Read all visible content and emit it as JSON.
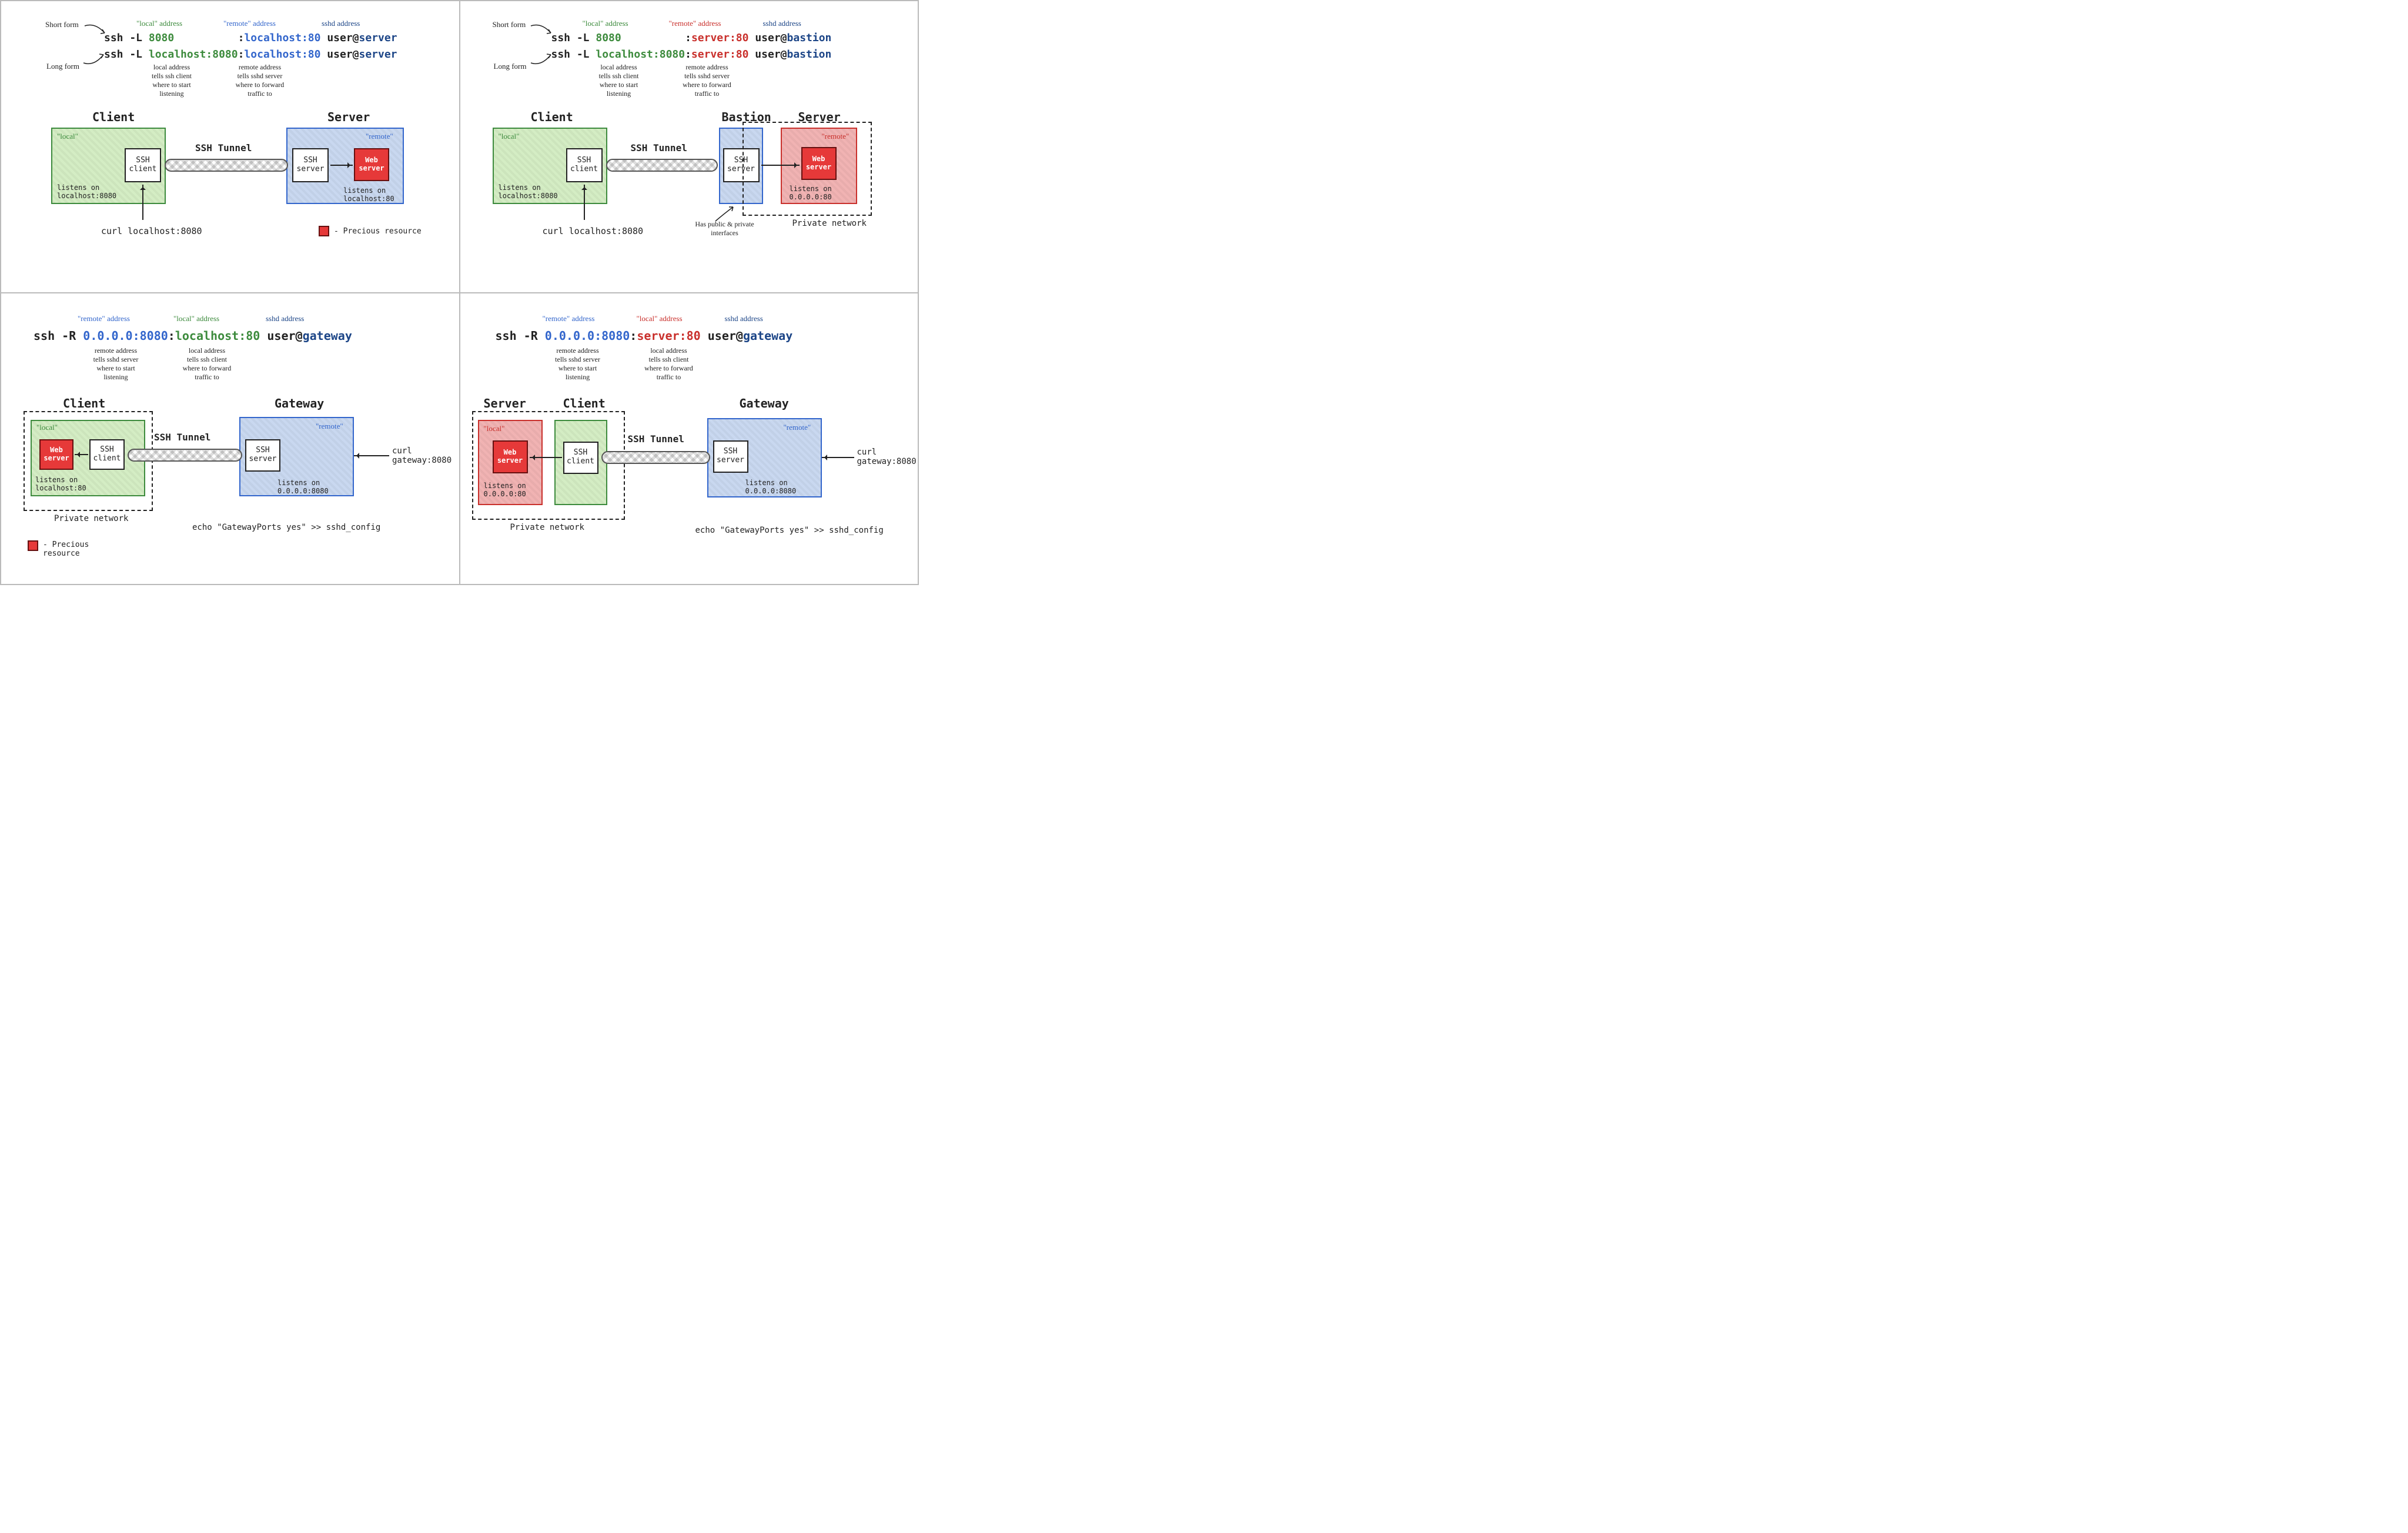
{
  "q1": {
    "annot": {
      "local": "\"local\" address",
      "remote": "\"remote\" address",
      "sshd": "sshd address"
    },
    "side": {
      "short": "Short form",
      "long": "Long form"
    },
    "cmd1": {
      "pre": "ssh -L ",
      "local": "8080",
      "mid": "          :",
      "remote": "localhost:80",
      "userat": " user@",
      "host": "server"
    },
    "cmd2": {
      "pre": "ssh -L ",
      "local": "localhost:8080",
      "mid": ":",
      "remote": "localhost:80",
      "userat": " user@",
      "host": "server"
    },
    "under": {
      "local": "local address\ntells ssh client\nwhere to start\nlistening",
      "remote": "remote address\ntells sshd server\nwhere to forward\ntraffic to"
    },
    "headings": {
      "client": "Client",
      "server": "Server"
    },
    "labels": {
      "localq": "\"local\"",
      "remoteq": "\"remote\"",
      "sshclient": "SSH\nclient",
      "sshserver": "SSH\nserver",
      "web": "Web\nserver",
      "tunnel": "SSH Tunnel",
      "listens_client": "listens on\nlocalhost:8080",
      "listens_server": "listens on\nlocalhost:80",
      "curl": "curl localhost:8080"
    },
    "legend": "- Precious resource"
  },
  "q2": {
    "annot": {
      "local": "\"local\" address",
      "remote": "\"remote\" address",
      "sshd": "sshd address"
    },
    "side": {
      "short": "Short form",
      "long": "Long form"
    },
    "cmd1": {
      "pre": "ssh -L ",
      "local": "8080",
      "mid": "          :",
      "remote": "server:80",
      "userat": " user@",
      "host": "bastion"
    },
    "cmd2": {
      "pre": "ssh -L ",
      "local": "localhost:8080",
      "mid": ":",
      "remote": "server:80",
      "userat": " user@",
      "host": "bastion"
    },
    "under": {
      "local": "local address\ntells ssh client\nwhere to start\nlistening",
      "remote": "remote address\ntells sshd server\nwhere to forward\ntraffic to"
    },
    "headings": {
      "client": "Client",
      "bastion": "Bastion",
      "server": "Server"
    },
    "labels": {
      "localq": "\"local\"",
      "remoteq": "\"remote\"",
      "sshclient": "SSH\nclient",
      "sshserver": "SSH\nserver",
      "web": "Web\nserver",
      "tunnel": "SSH Tunnel",
      "listens_client": "listens on\nlocalhost:8080",
      "listens_server": "listens on\n0.0.0.0:80",
      "curl": "curl localhost:8080",
      "priv": "Private network",
      "bastion_note": "Has public & private\ninterfaces"
    }
  },
  "q3": {
    "annot": {
      "remote": "\"remote\" address",
      "local": "\"local\" address",
      "sshd": "sshd address"
    },
    "cmd": {
      "pre": "ssh -R ",
      "remote": "0.0.0.0:8080",
      "mid": ":",
      "local": "localhost:80",
      "userat": " user@",
      "host": "gateway"
    },
    "under": {
      "remote": "remote address\ntells sshd server\nwhere to start\nlistening",
      "local": "local address\ntells ssh client\nwhere to forward\ntraffic to"
    },
    "headings": {
      "client": "Client",
      "gateway": "Gateway"
    },
    "labels": {
      "localq": "\"local\"",
      "remoteq": "\"remote\"",
      "sshclient": "SSH\nclient",
      "sshserver": "SSH\nserver",
      "web": "Web\nserver",
      "tunnel": "SSH Tunnel",
      "listens_client": "listens on\nlocalhost:80",
      "listens_gateway": "listens on\n0.0.0.0:8080",
      "curl": "curl\ngateway:8080",
      "priv": "Private network",
      "echo": "echo \"GatewayPorts yes\" >> sshd_config"
    },
    "legend": "- Precious\n  resource"
  },
  "q4": {
    "annot": {
      "remote": "\"remote\" address",
      "local": "\"local\" address",
      "sshd": "sshd address"
    },
    "cmd": {
      "pre": "ssh -R ",
      "remote": "0.0.0.0:8080",
      "mid": ":",
      "local": "server:80",
      "userat": " user@",
      "host": "gateway"
    },
    "under": {
      "remote": "remote address\ntells sshd server\nwhere to start\nlistening",
      "local": "local address\ntells ssh client\nwhere to forward\ntraffic to"
    },
    "headings": {
      "server": "Server",
      "client": "Client",
      "gateway": "Gateway"
    },
    "labels": {
      "localq": "\"local\"",
      "remoteq": "\"remote\"",
      "sshclient": "SSH\nclient",
      "sshserver": "SSH\nserver",
      "web": "Web\nserver",
      "tunnel": "SSH Tunnel",
      "listens_server": "listens on\n0.0.0.0:80",
      "listens_gateway": "listens on\n0.0.0.0:8080",
      "curl": "curl\ngateway:8080",
      "priv": "Private network",
      "echo": "echo \"GatewayPorts yes\" >> sshd_config"
    }
  }
}
